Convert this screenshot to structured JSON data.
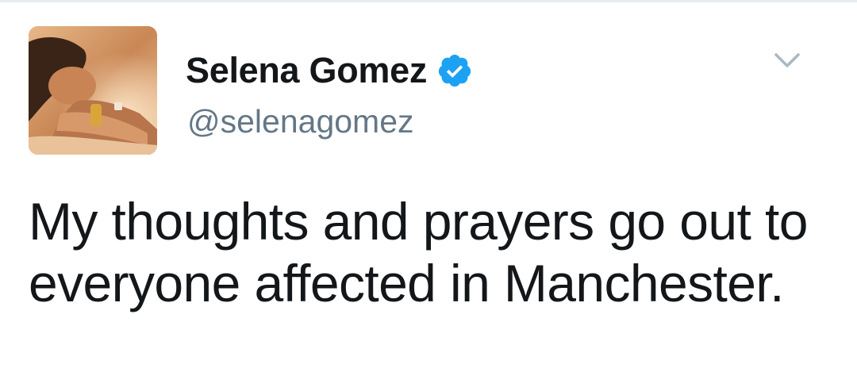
{
  "tweet": {
    "author": {
      "display_name": "Selena Gomez",
      "handle": "@selenagomez",
      "verified": true,
      "avatar_icon": "profile-photo",
      "verified_icon": "verified-badge-icon"
    },
    "text": "My thoughts and prayers go out to everyone affected in Manchester.",
    "menu_icon": "chevron-down-icon"
  },
  "colors": {
    "name": "#14171a",
    "handle": "#657786",
    "verified": "#1da1f2",
    "chevron": "#aab8c2",
    "divider": "#e6ecf0"
  }
}
